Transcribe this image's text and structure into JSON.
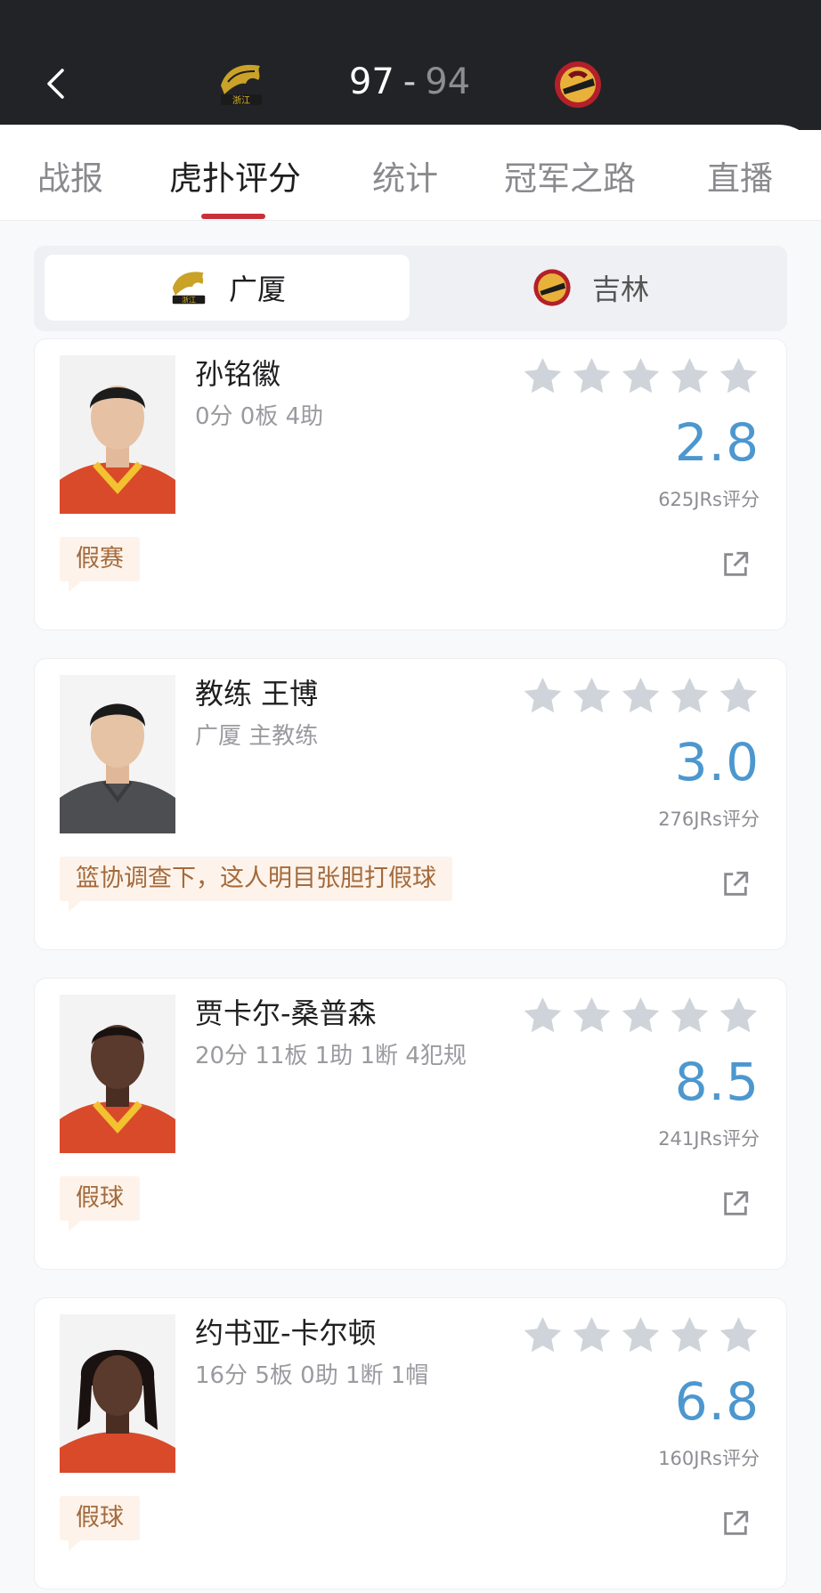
{
  "header": {
    "score_home": "97",
    "score_separator": "-",
    "score_away": "94",
    "home_logo_icon": "zhejiang-team-logo",
    "away_logo_icon": "jilin-team-logo"
  },
  "tabs": [
    {
      "label": "战报",
      "active": false
    },
    {
      "label": "虎扑评分",
      "active": true
    },
    {
      "label": "统计",
      "active": false
    },
    {
      "label": "冠军之路",
      "active": false
    },
    {
      "label": "直播",
      "active": false
    }
  ],
  "team_switch": {
    "home_label": "广厦",
    "away_label": "吉林",
    "selected": "广厦"
  },
  "players": [
    {
      "name": "孙铭徽",
      "stats": "0分 0板 4助",
      "rating": "2.8",
      "votes": "625JRs评分",
      "comment": "假赛",
      "photo": "player-portrait-red-jersey"
    },
    {
      "name": "教练 王博",
      "stats": "广厦 主教练",
      "rating": "3.0",
      "votes": "276JRs评分",
      "comment": "篮协调查下，这人明目张胆打假球",
      "photo": "coach-portrait-gray-shirt"
    },
    {
      "name": "贾卡尔-桑普森",
      "stats": "20分 11板 1助 1断 4犯规",
      "rating": "8.5",
      "votes": "241JRs评分",
      "comment": "假球",
      "photo": "player-portrait-red-jersey"
    },
    {
      "name": "约书亚-卡尔顿",
      "stats": "16分 5板 0助 1断 1帽",
      "rating": "6.8",
      "votes": "160JRs评分",
      "comment": "假球",
      "photo": "player-portrait-red-jersey"
    }
  ],
  "colors": {
    "header_bg": "#222326",
    "tab_indicator": "#c9313a",
    "rating_blue": "#4d97cf",
    "comment_bg": "#fdf3ea",
    "comment_text": "#a46a3c",
    "star_gray": "#cfd3da"
  }
}
